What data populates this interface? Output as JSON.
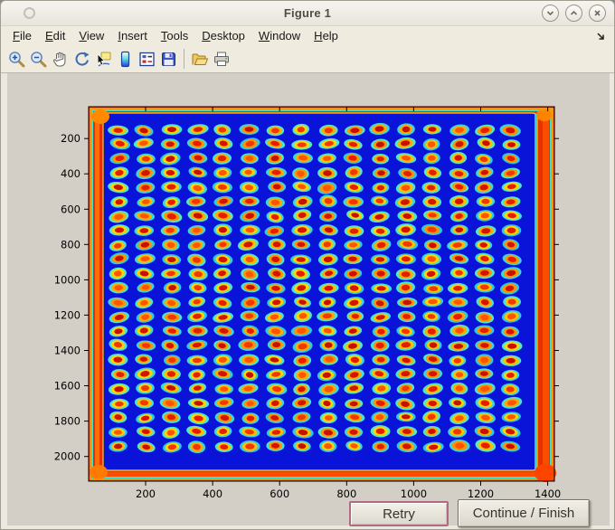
{
  "window": {
    "title": "Figure 1",
    "controls": [
      {
        "name": "minimize-button",
        "icon": "chevron-down-icon"
      },
      {
        "name": "maximize-button",
        "icon": "chevron-up-icon"
      },
      {
        "name": "close-button",
        "icon": "close-x-icon"
      }
    ],
    "app_icon": "window-menu-circle-icon"
  },
  "menu": {
    "items": [
      "File",
      "Edit",
      "View",
      "Insert",
      "Tools",
      "Desktop",
      "Window",
      "Help"
    ],
    "dock_icon": "dock-figure-arrow-icon"
  },
  "toolbar": {
    "icons": [
      "zoom-in-icon",
      "zoom-out-icon",
      "pan-hand-icon",
      "rotate-3d-icon",
      "data-cursor-icon",
      "colorbar-icon",
      "insert-legend-icon",
      "save-icon",
      "open-folder-icon",
      "print-icon"
    ]
  },
  "figure": {
    "buttons": [
      {
        "label": "Retry"
      },
      {
        "label": "Continue / Finish"
      }
    ]
  },
  "chart_data": {
    "type": "heatmap",
    "title": "",
    "xlabel": "",
    "ylabel": "",
    "description": "Jet-colormap scan of a spotted microplate/microarray: dark blue field with red/orange saturated borders and a regular grid of elliptical spots (red cores, yellow-orange rings, cyan halos).",
    "colormap": "jet",
    "x_ticks": [
      200,
      400,
      600,
      800,
      1000,
      1200,
      1400
    ],
    "y_ticks": [
      200,
      400,
      600,
      800,
      1000,
      1200,
      1400,
      1600,
      1800,
      2000
    ],
    "x_range": [
      30,
      1420
    ],
    "y_range": [
      20,
      2140
    ],
    "grid_on": false,
    "legend": null,
    "grid": {
      "cols": 16,
      "rows": 23,
      "x0": 120,
      "dx": 78,
      "y0": 150,
      "dy": 81.5
    },
    "colors": {
      "field_blue": "#0a13d8",
      "border_red": "#e83000",
      "border_orange": "#ff7a00",
      "border_yellow": "#ffd300",
      "border_cyan": "#38dfd8",
      "spot_halo": [
        "#3bd6e4",
        "#49e3df",
        "#2fc9e8",
        "#55e8c9"
      ],
      "spot_ring": [
        "#ffd400",
        "#ffc000",
        "#ffaa00",
        "#ff9400"
      ],
      "spot_core": [
        "#e61e00",
        "#d41400",
        "#f23800",
        "#c81000",
        "#ff5400"
      ],
      "axis": "#000000"
    }
  }
}
